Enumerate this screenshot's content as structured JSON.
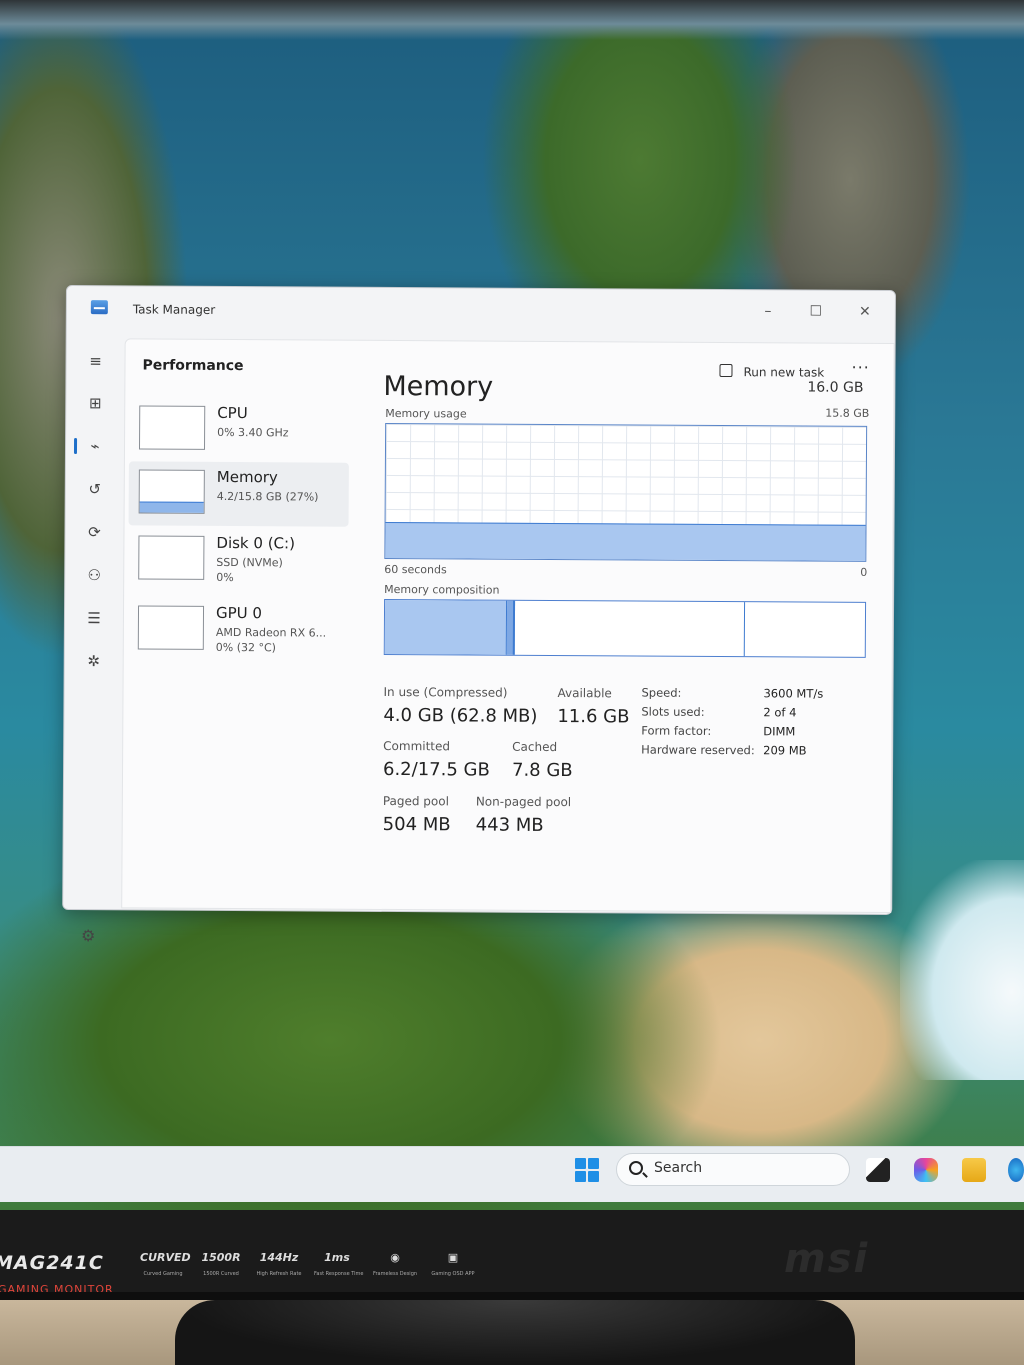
{
  "window": {
    "title": "Task Manager",
    "minimize": "–",
    "maximize": "☐",
    "close": "✕"
  },
  "header": {
    "page_title": "Performance",
    "run_new_task": "Run new task",
    "more": "···"
  },
  "sidebar": {
    "items": [
      {
        "name": "CPU",
        "line1": "0% 3.40 GHz",
        "line2": ""
      },
      {
        "name": "Memory",
        "line1": "4.2/15.8 GB (27%)",
        "line2": ""
      },
      {
        "name": "Disk 0 (C:)",
        "line1": "SSD (NVMe)",
        "line2": "0%"
      },
      {
        "name": "GPU 0",
        "line1": "AMD Radeon RX 6...",
        "line2": "0% (32 °C)"
      }
    ],
    "memory_usage_fraction": 0.27
  },
  "memory": {
    "title": "Memory",
    "total": "16.0 GB",
    "usage_label": "Memory usage",
    "usage_max": "15.8 GB",
    "usage_fraction": 0.27,
    "time_label": "60 seconds",
    "time_zero": "0",
    "composition_label": "Memory composition",
    "stats": {
      "in_use_label": "In use (Compressed)",
      "in_use_value": "4.0 GB (62.8 MB)",
      "available_label": "Available",
      "available_value": "11.6 GB",
      "committed_label": "Committed",
      "committed_value": "6.2/17.5 GB",
      "cached_label": "Cached",
      "cached_value": "7.8 GB",
      "paged_label": "Paged pool",
      "paged_value": "504 MB",
      "nonpaged_label": "Non-paged pool",
      "nonpaged_value": "443 MB"
    },
    "details": {
      "speed_label": "Speed:",
      "speed_value": "3600 MT/s",
      "slots_label": "Slots used:",
      "slots_value": "2 of 4",
      "form_label": "Form factor:",
      "form_value": "DIMM",
      "hw_label": "Hardware reserved:",
      "hw_value": "209 MB"
    }
  },
  "taskbar": {
    "search_placeholder": "Search"
  },
  "monitor": {
    "model": "MAG241C",
    "model_sub": "GAMING MONITOR",
    "brand": "msi",
    "badges": [
      {
        "top": "CURVED",
        "bottom": "Curved Gaming"
      },
      {
        "top": "1500R",
        "bottom": "1500R Curved"
      },
      {
        "top": "144Hz",
        "bottom": "High Refresh Rate"
      },
      {
        "top": "1ms",
        "bottom": "Fast Response Time"
      },
      {
        "top": "◉",
        "bottom": "Frameless Design"
      },
      {
        "top": "▣",
        "bottom": "Gaming OSD APP"
      }
    ]
  },
  "colors": {
    "accent": "#1e6fc9",
    "graph_fill": "#a9c7f0",
    "graph_line": "#3e7bd0"
  }
}
